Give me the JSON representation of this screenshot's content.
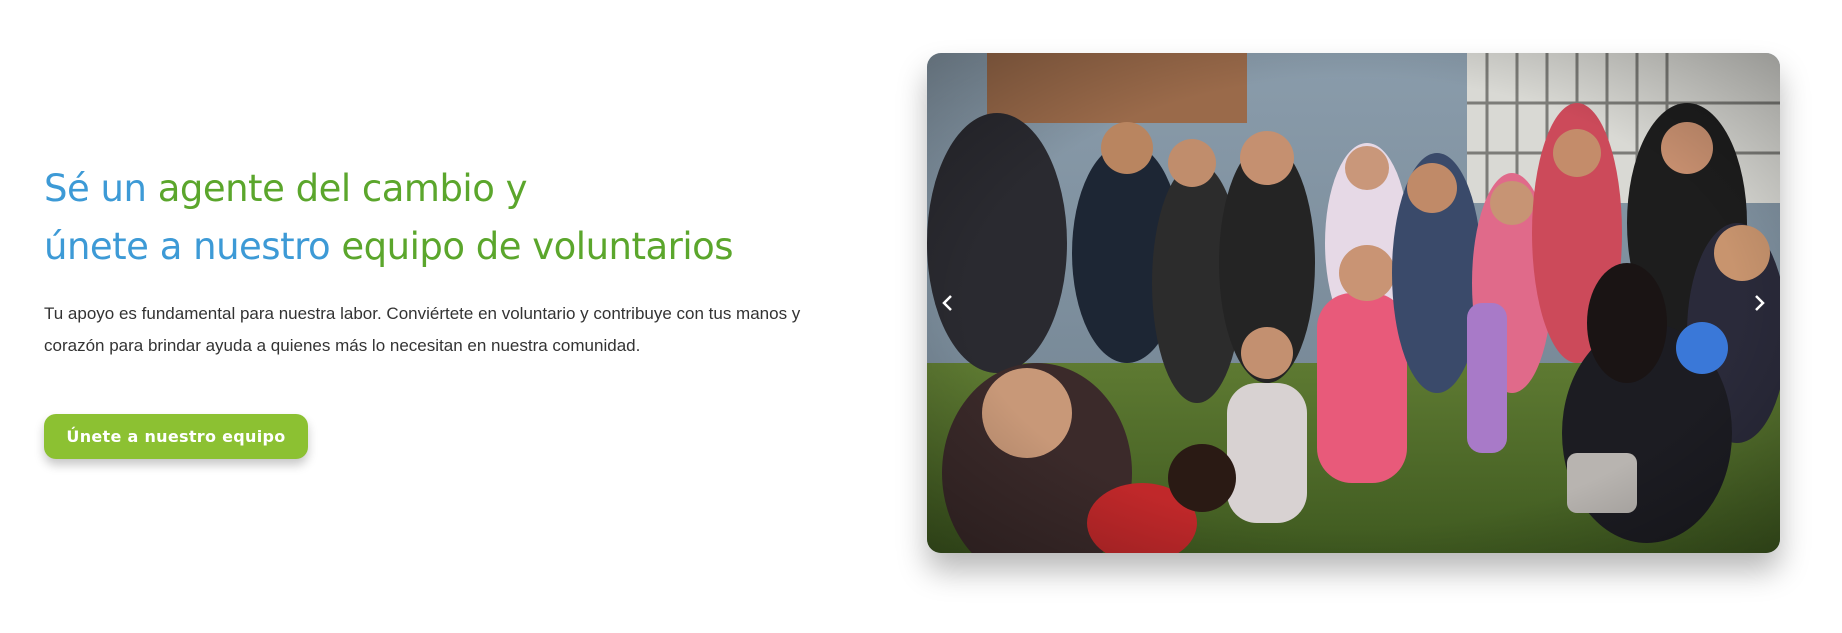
{
  "section": {
    "headline": {
      "line1_part1": "Sé un ",
      "line1_part2": "agente del cambio y",
      "line2_part1": "únete a nuestro ",
      "line2_part2": "equipo de voluntarios"
    },
    "description_line1": "Tu apoyo es fundamental para nuestra labor. Conviértete en voluntario y contribuye con tus manos y",
    "description_line2": "corazón para brindar ayuda a quienes más lo necesitan en nuestra comunidad.",
    "cta_label": "Únete a nuestro equipo"
  },
  "carousel": {
    "prev_icon": "chevron-left-icon",
    "next_icon": "chevron-right-icon"
  },
  "colors": {
    "headline_blue": "#3d9ad6",
    "headline_green": "#5ba62c",
    "cta_background": "#8cc132",
    "body_text": "#333333"
  }
}
